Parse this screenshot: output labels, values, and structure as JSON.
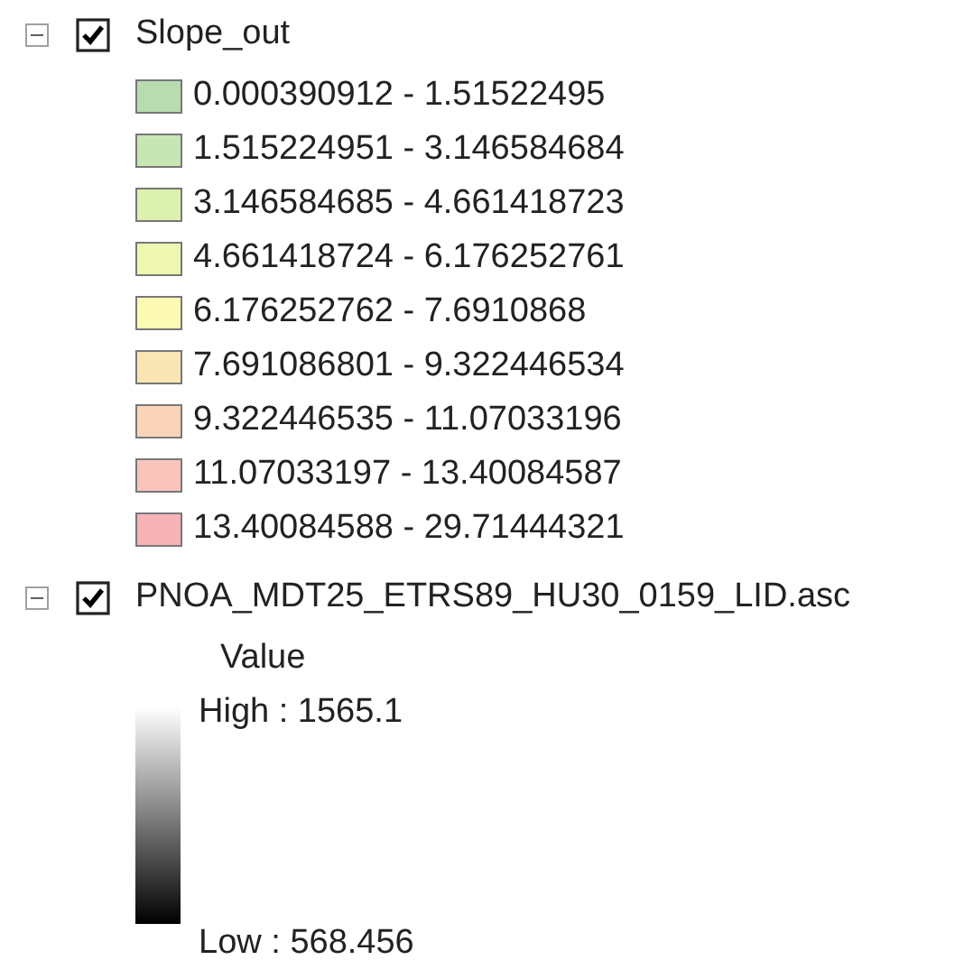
{
  "layers": [
    {
      "kind": "classes",
      "name": "Slope_out",
      "checked": true,
      "expanded": true,
      "classes": [
        {
          "label": "0.000390912 - 1.51522495",
          "color": "#b8dcb0"
        },
        {
          "label": "1.515224951 - 3.146584684",
          "color": "#c8e6b4"
        },
        {
          "label": "3.146584685 - 4.661418723",
          "color": "#dcf0b0"
        },
        {
          "label": "4.661418724 - 6.176252761",
          "color": "#eef8b0"
        },
        {
          "label": "6.176252762 - 7.6910868",
          "color": "#fcfab4"
        },
        {
          "label": "7.691086801 - 9.322446534",
          "color": "#fae6b4"
        },
        {
          "label": "9.322446535 - 11.07033196",
          "color": "#fad4b8"
        },
        {
          "label": "11.07033197 - 13.40084587",
          "color": "#f8c4bc"
        },
        {
          "label": "13.40084588 - 29.71444321",
          "color": "#f6b4b8"
        }
      ]
    },
    {
      "kind": "stretch",
      "name": "PNOA_MDT25_ETRS89_HU30_0159_LID.asc",
      "checked": true,
      "expanded": true,
      "field": "Value",
      "high": "High : 1565.1",
      "low": "Low : 568.456"
    }
  ]
}
